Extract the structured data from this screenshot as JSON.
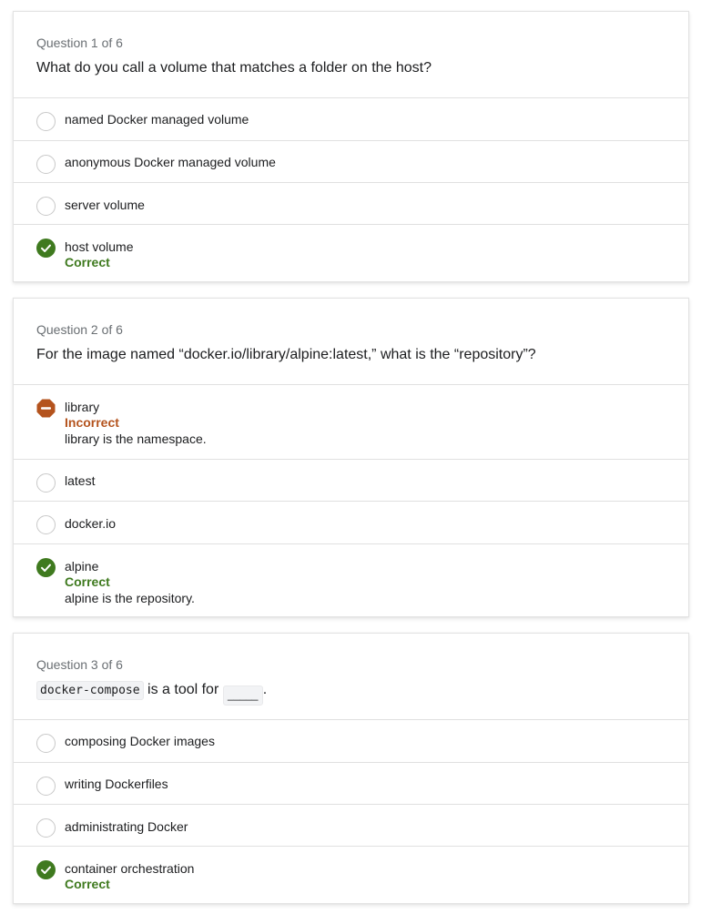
{
  "questions": [
    {
      "counter": "Question 1 of 6",
      "text": "What do you call a volume that matches a folder on the host?",
      "options": [
        {
          "label": "named Docker managed volume"
        },
        {
          "label": "anonymous Docker managed volume"
        },
        {
          "label": "server volume"
        },
        {
          "label": "host volume",
          "feedback": "Correct"
        }
      ]
    },
    {
      "counter": "Question 2 of 6",
      "text": "For the image named “docker.io/library/alpine:latest,” what is the “repository”?",
      "options": [
        {
          "label": "library",
          "feedback": "Incorrect",
          "explanation": "library is the namespace."
        },
        {
          "label": "latest"
        },
        {
          "label": "docker.io"
        },
        {
          "label": "alpine",
          "feedback": "Correct",
          "explanation": "alpine is the repository."
        }
      ]
    },
    {
      "counter": "Question 3 of 6",
      "code": "docker-compose",
      "text_middle": " is a tool for ",
      "blank": "_____",
      "text_end": ".",
      "options": [
        {
          "label": "composing Docker images"
        },
        {
          "label": "writing Dockerfiles"
        },
        {
          "label": "administrating Docker"
        },
        {
          "label": "container orchestration",
          "feedback": "Correct"
        }
      ]
    }
  ],
  "colors": {
    "correct": "#3f7a1f",
    "incorrect": "#b4531d",
    "muted": "#6a6f73"
  },
  "icons": {
    "correct": "check-circle-icon",
    "incorrect": "no-entry-icon",
    "unselected": "radio-empty-icon"
  }
}
